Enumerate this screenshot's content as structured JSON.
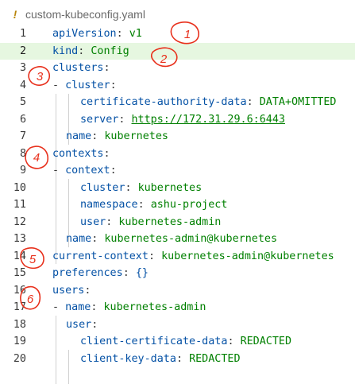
{
  "tab": {
    "icon": "!",
    "filename": "custom-kubeconfig.yaml"
  },
  "colors": {
    "key": "#0451a5",
    "value": "#008000",
    "highlight": "#e6f7e0",
    "annotation": "#e8301c"
  },
  "lines": [
    {
      "n": "1",
      "key": "apiVersion",
      "value": "v1"
    },
    {
      "n": "2",
      "key": "kind",
      "value": "Config"
    },
    {
      "n": "3",
      "key": "clusters",
      "value": ""
    },
    {
      "n": "4",
      "dash": "- ",
      "key": "cluster",
      "value": ""
    },
    {
      "n": "5",
      "key": "certificate-authority-data",
      "value": "DATA+OMITTED"
    },
    {
      "n": "6",
      "key": "server",
      "value": "https://172.31.29.6:6443"
    },
    {
      "n": "7",
      "key": "name",
      "value": "kubernetes"
    },
    {
      "n": "8",
      "key": "contexts",
      "value": ""
    },
    {
      "n": "9",
      "dash": "- ",
      "key": "context",
      "value": ""
    },
    {
      "n": "10",
      "key": "cluster",
      "value": "kubernetes"
    },
    {
      "n": "11",
      "key": "namespace",
      "value": "ashu-project"
    },
    {
      "n": "12",
      "key": "user",
      "value": "kubernetes-admin"
    },
    {
      "n": "13",
      "key": "name",
      "value": "kubernetes-admin@kubernetes"
    },
    {
      "n": "14",
      "key": "current-context",
      "value": "kubernetes-admin@kubernetes"
    },
    {
      "n": "15",
      "key": "preferences",
      "value": "{}"
    },
    {
      "n": "16",
      "key": "users",
      "value": ""
    },
    {
      "n": "17",
      "dash": "- ",
      "key": "name",
      "value": "kubernetes-admin"
    },
    {
      "n": "18",
      "key": "user",
      "value": ""
    },
    {
      "n": "19",
      "key": "client-certificate-data",
      "value": "REDACTED"
    },
    {
      "n": "20",
      "key": "client-key-data",
      "value": "REDACTED"
    }
  ],
  "annotations": [
    "1",
    "2",
    "3",
    "4",
    "5",
    "6"
  ]
}
